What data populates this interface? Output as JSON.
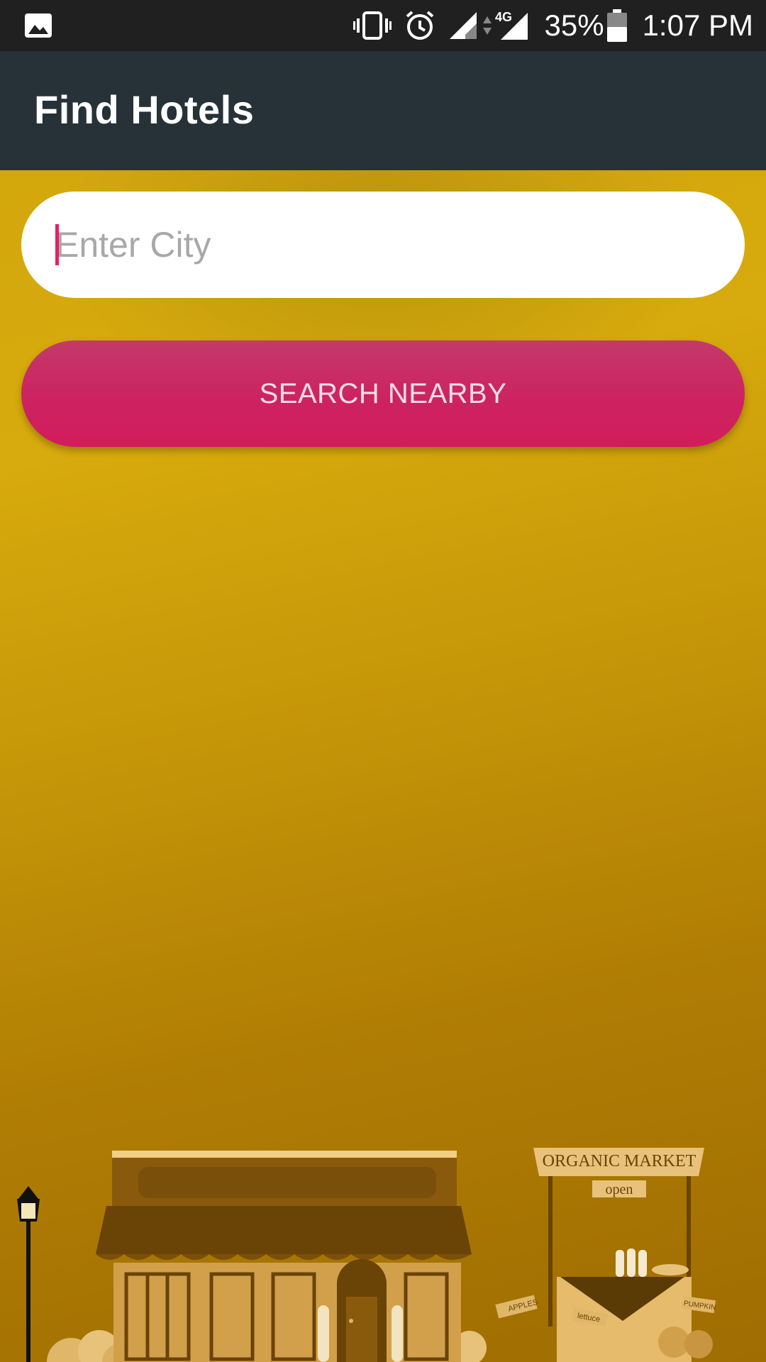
{
  "status_bar": {
    "battery_percent": "35%",
    "network": "4G",
    "time": "1:07 PM",
    "icons": [
      "image-notification-icon",
      "vibrate-icon",
      "alarm-icon",
      "signal-icon",
      "data-arrows-icon",
      "signal-4g-icon",
      "battery-icon"
    ]
  },
  "app_bar": {
    "title": "Find Hotels"
  },
  "search": {
    "placeholder": "Enter City",
    "value": ""
  },
  "actions": {
    "search_nearby_label": "SEARCH NEARBY"
  },
  "illustration": {
    "market_sign": "ORGANIC MARKET",
    "open_sign": "open",
    "tag_apples": "APPLES",
    "tag_lettuce": "lettuce",
    "tag_pumpkin": "PUMPKIN"
  },
  "colors": {
    "status_bar": "#202020",
    "app_bar": "#263238",
    "accent": "#e91e63",
    "button": "#cd2360",
    "background": "#c89a09"
  }
}
